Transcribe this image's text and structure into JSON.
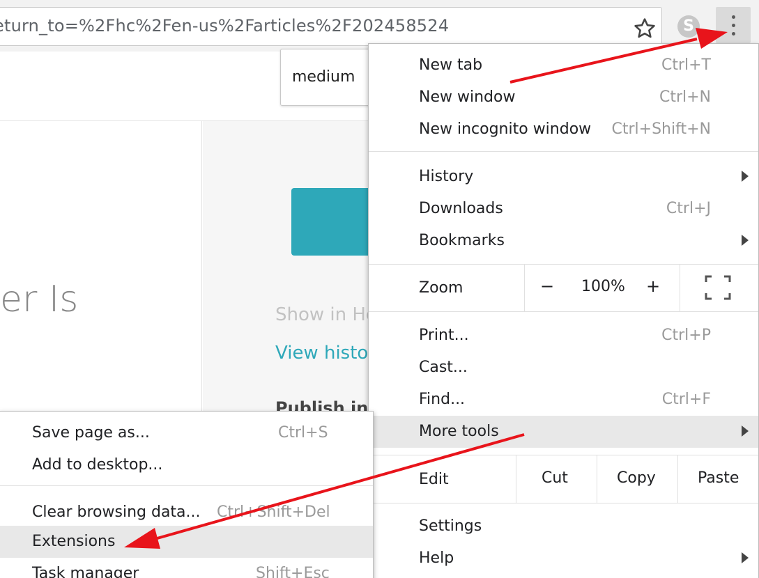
{
  "toolbar": {
    "url": "eturn_to=%2Fhc%2Fen-us%2Farticles%2F202458524"
  },
  "page": {
    "font_size_value": "medium",
    "heading_partial": "er Is",
    "show_in_help": "Show in He",
    "view_history": "View histor",
    "publish_in": "Publish in"
  },
  "menu": {
    "new_tab": {
      "label": "New tab",
      "shortcut": "Ctrl+T"
    },
    "new_window": {
      "label": "New window",
      "shortcut": "Ctrl+N"
    },
    "new_incognito": {
      "label": "New incognito window",
      "shortcut": "Ctrl+Shift+N"
    },
    "history": {
      "label": "History"
    },
    "downloads": {
      "label": "Downloads",
      "shortcut": "Ctrl+J"
    },
    "bookmarks": {
      "label": "Bookmarks"
    },
    "zoom": {
      "label": "Zoom",
      "minus": "−",
      "level": "100%",
      "plus": "+"
    },
    "print": {
      "label": "Print...",
      "shortcut": "Ctrl+P"
    },
    "cast": {
      "label": "Cast..."
    },
    "find": {
      "label": "Find...",
      "shortcut": "Ctrl+F"
    },
    "more_tools": {
      "label": "More tools"
    },
    "edit": {
      "label": "Edit",
      "cut": "Cut",
      "copy": "Copy",
      "paste": "Paste"
    },
    "settings": {
      "label": "Settings"
    },
    "help": {
      "label": "Help"
    }
  },
  "submenu": {
    "save_page": {
      "label": "Save page as...",
      "shortcut": "Ctrl+S"
    },
    "add_desktop": {
      "label": "Add to desktop..."
    },
    "clear_data": {
      "label": "Clear browsing data...",
      "shortcut": "Ctrl+Shift+Del"
    },
    "extensions": {
      "label": "Extensions"
    },
    "task_manager": {
      "label": "Task manager",
      "shortcut": "Shift+Esc"
    }
  },
  "colors": {
    "accent": "#2ea8b9",
    "annotation_arrow": "#e8141b",
    "highlight": "#e8e8e8"
  }
}
